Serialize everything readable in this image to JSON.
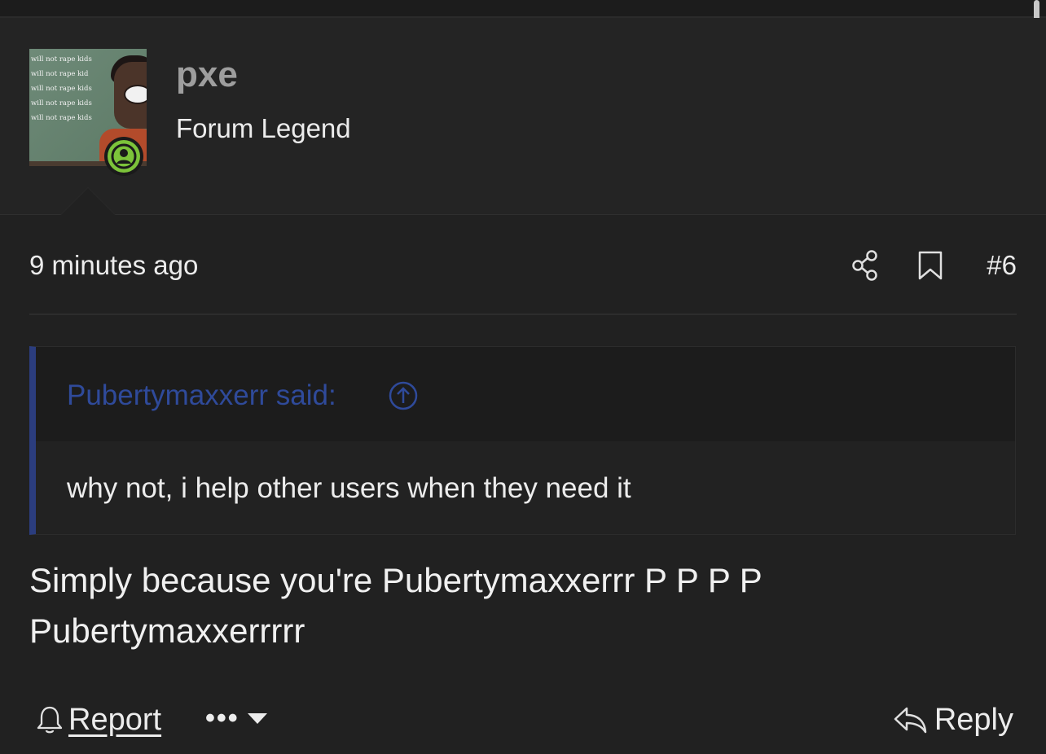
{
  "user": {
    "avatar_text": [
      "will not rape kids",
      "will not rape kid",
      "will not rape kids",
      "will not rape kids",
      "will not rape kids"
    ],
    "username": "pxe",
    "title": "Forum Legend",
    "status_color": "#7cc33a"
  },
  "post": {
    "timestamp": "9 minutes ago",
    "number": "#6",
    "icons": [
      "share-icon",
      "bookmark-icon"
    ]
  },
  "quote": {
    "author_line": "Pubertymaxxerr said:",
    "body": "why not, i help other users when they need it",
    "accent_color": "#2b3d7e"
  },
  "message": {
    "line1": "Simply because you're Pubertymaxxerrr P P P P",
    "line2": "Pubertymaxxerrrrr"
  },
  "actions": {
    "report_label": "Report",
    "more_label": "•••",
    "reply_label": "Reply"
  }
}
